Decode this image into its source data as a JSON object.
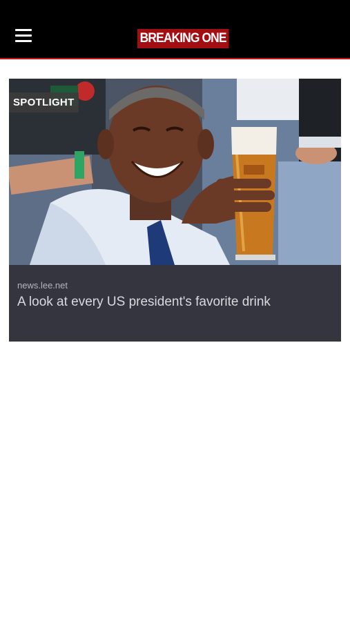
{
  "header": {
    "logo_text": "BREAKING ONE",
    "menu_icon": "hamburger-menu-icon",
    "background": "#000000",
    "accent_color": "#c8141a"
  },
  "article": {
    "badge": "SPOTLIGHT",
    "source": "news.lee.net",
    "headline": "A look at every US president's favorite drink",
    "card_background": "#34353f"
  }
}
